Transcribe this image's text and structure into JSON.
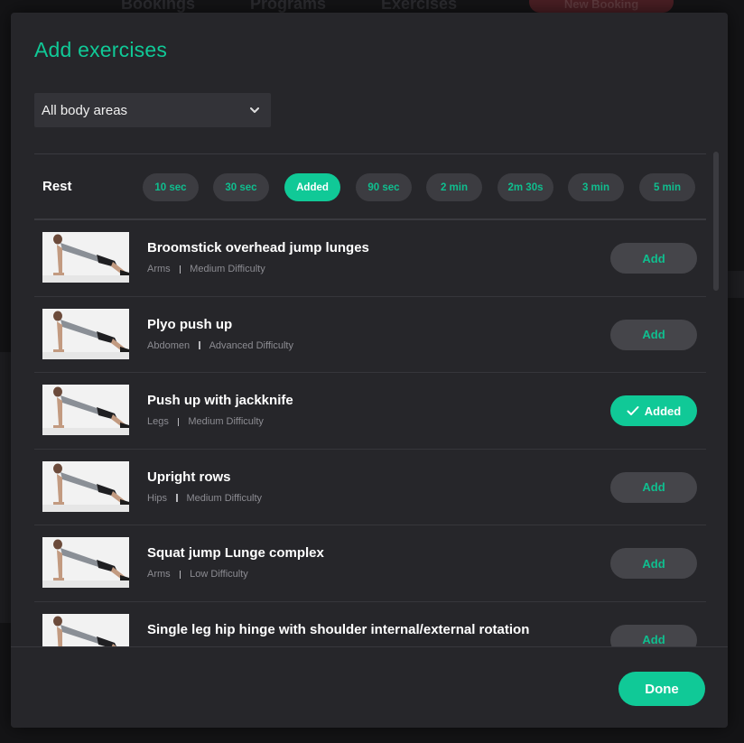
{
  "background": {
    "nav_items": [
      "Bookings",
      "Programs",
      "Exercises"
    ],
    "new_booking_label": "New Booking"
  },
  "modal": {
    "title": "Add exercises",
    "body_area_select": {
      "value": "All body areas"
    },
    "rest": {
      "label": "Rest",
      "options": [
        "10 sec",
        "30 sec",
        "Added",
        "90 sec",
        "2 min",
        "2m 30s",
        "3 min",
        "5 min"
      ],
      "active_index": 2
    },
    "exercises": [
      {
        "name": "Broomstick overhead jump lunges",
        "area": "Arms",
        "difficulty": "Medium Difficulty",
        "button": "Add",
        "added": false
      },
      {
        "name": "Plyo push up",
        "area": "Abdomen",
        "difficulty": "Advanced Difficulty",
        "button": "Add",
        "added": false
      },
      {
        "name": "Push up with jackknife",
        "area": "Legs",
        "difficulty": "Medium Difficulty",
        "button": "Added",
        "added": true
      },
      {
        "name": "Upright rows",
        "area": "Hips",
        "difficulty": "Medium Difficulty",
        "button": "Add",
        "added": false
      },
      {
        "name": "Squat jump Lunge complex",
        "area": "Arms",
        "difficulty": "Low Difficulty",
        "button": "Add",
        "added": false
      },
      {
        "name": "Single leg hip hinge with shoulder internal/external rotation",
        "area": "",
        "difficulty": "",
        "button": "Add",
        "added": false
      }
    ],
    "done_label": "Done"
  },
  "colors": {
    "accent": "#10c997",
    "modal_bg": "#26262a",
    "button_bg": "#45454a",
    "page_bg": "#141416"
  }
}
